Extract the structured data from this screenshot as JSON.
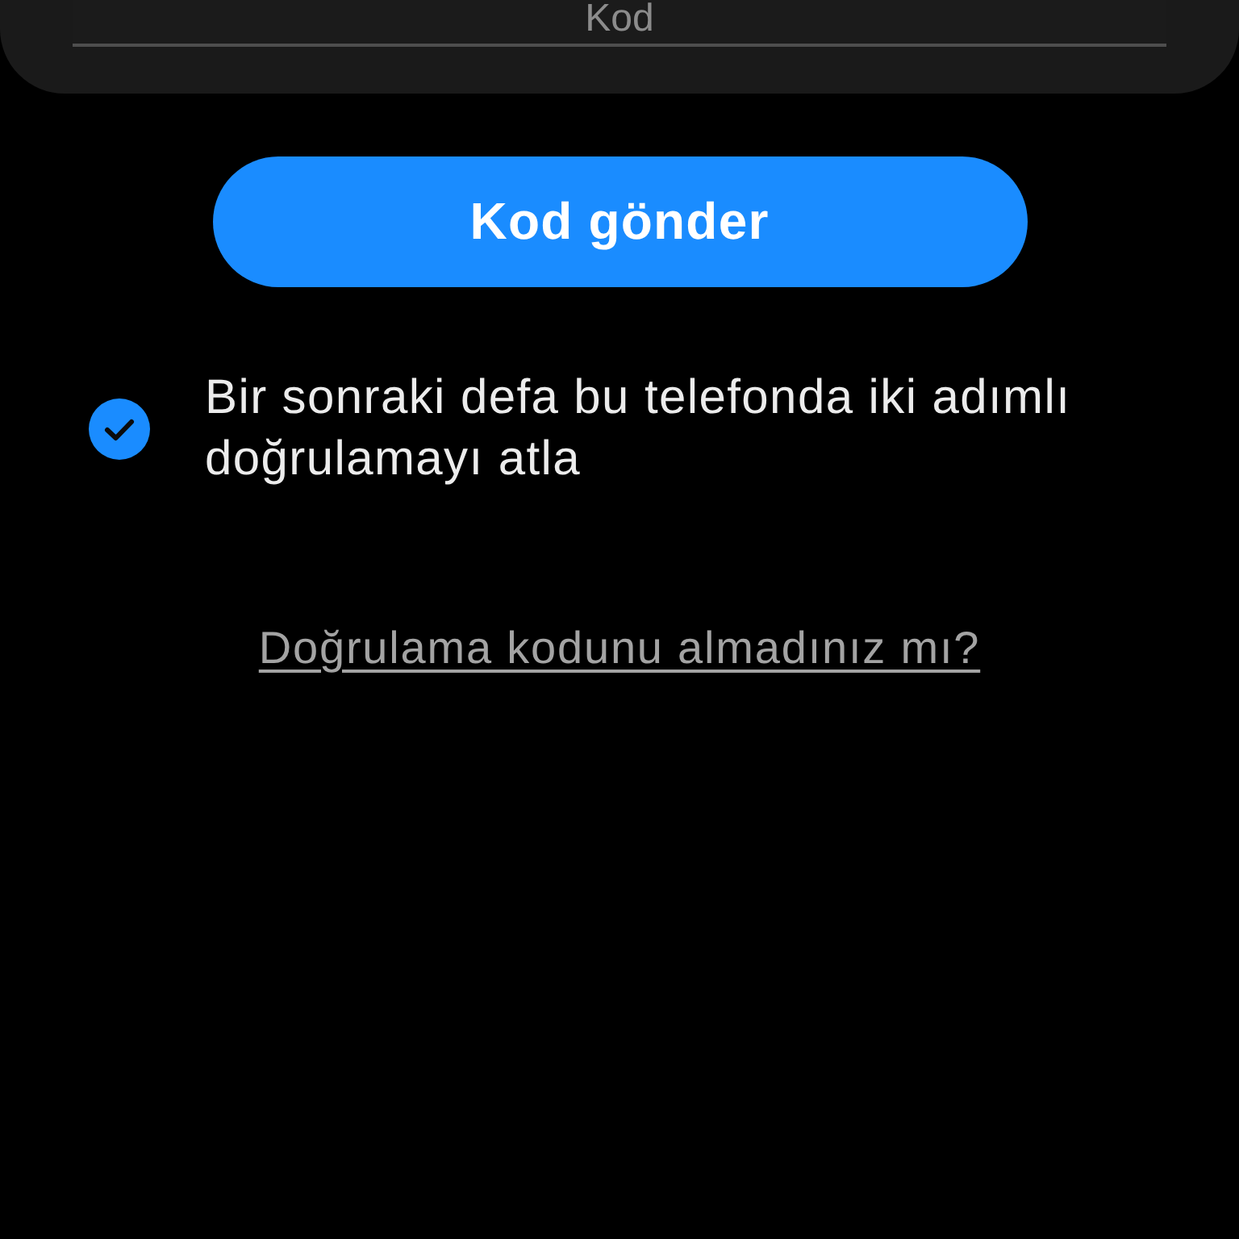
{
  "code_field": {
    "placeholder": "Kod"
  },
  "send_button": {
    "label": "Kod gönder"
  },
  "skip_option": {
    "label": "Bir sonraki defa bu telefonda iki adımlı doğrulamayı atla",
    "checked": true
  },
  "resend_link": {
    "label": "Doğrulama kodunu almadınız mı?"
  }
}
